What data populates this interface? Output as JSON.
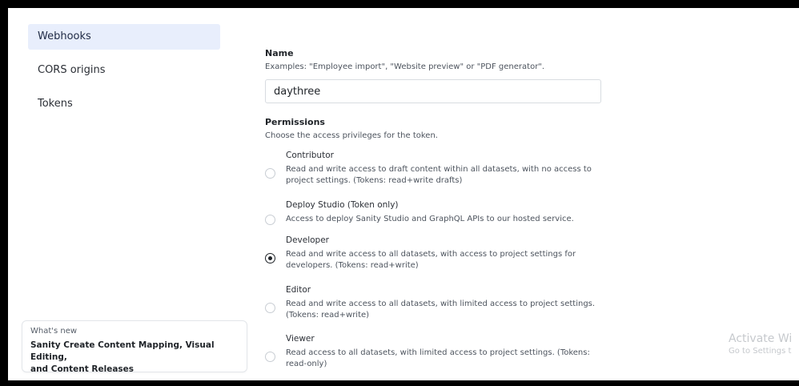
{
  "sidebar": {
    "items": [
      {
        "label": "Webhooks"
      },
      {
        "label": "CORS origins"
      },
      {
        "label": "Tokens"
      }
    ]
  },
  "whats_new": {
    "label": "What's new",
    "text_line1": "Sanity Create Content Mapping, Visual Editing,",
    "text_line2": "and Content Releases"
  },
  "form": {
    "name_label": "Name",
    "name_desc": "Examples: \"Employee import\", \"Website preview\" or \"PDF generator\".",
    "name_value": "daythree",
    "permissions_label": "Permissions",
    "permissions_desc": "Choose the access privileges for the token.",
    "options": [
      {
        "title": "Contributor",
        "desc": "Read and write access to draft content within all datasets, with no access to project settings. (Tokens: read+write drafts)",
        "selected": false
      },
      {
        "title": "Deploy Studio (Token only)",
        "desc": "Access to deploy Sanity Studio and GraphQL APIs to our hosted service.",
        "selected": false
      },
      {
        "title": "Developer",
        "desc": "Read and write access to all datasets, with access to project settings for developers. (Tokens: read+write)",
        "selected": true
      },
      {
        "title": "Editor",
        "desc": "Read and write access to all datasets, with limited access to project settings. (Tokens: read+write)",
        "selected": false
      },
      {
        "title": "Viewer",
        "desc": "Read access to all datasets, with limited access to project settings. (Tokens: read-only)",
        "selected": false
      }
    ]
  },
  "watermark": {
    "line1": "Activate Wi",
    "line2": "Go to Settings t"
  }
}
